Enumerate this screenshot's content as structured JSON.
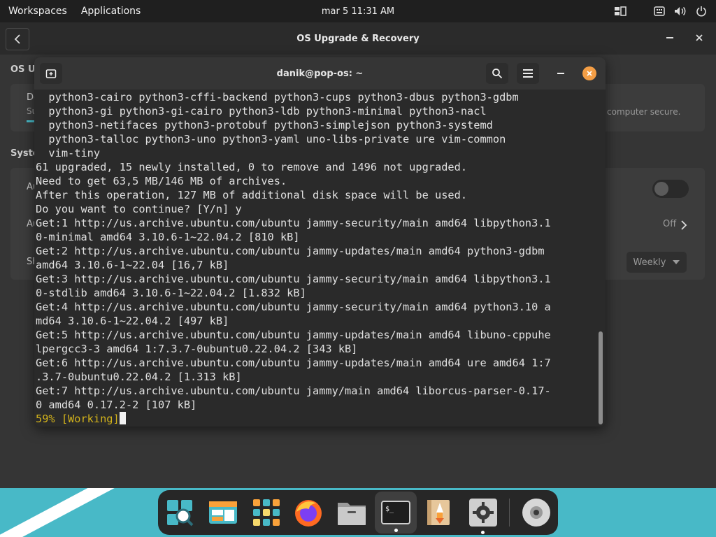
{
  "top_panel": {
    "workspaces": "Workspaces",
    "applications": "Applications",
    "clock": "mar 5  11:31 AM"
  },
  "settings": {
    "title": "OS Upgrade & Recovery",
    "section_title": "OS Up",
    "card_heading": "Do",
    "card_sub": "Su",
    "card_tail": "computer secure.",
    "system_label": "Syste",
    "row1": "Au",
    "row2": "Au",
    "row2_value": "Off",
    "row3": "Sh",
    "schedule_value": "Weekly"
  },
  "terminal": {
    "title": "danik@pop-os: ~",
    "lines": [
      "  python3-cairo python3-cffi-backend python3-cups python3-dbus python3-gdbm",
      "  python3-gi python3-gi-cairo python3-ldb python3-minimal python3-nacl",
      "  python3-netifaces python3-protobuf python3-simplejson python3-systemd",
      "  python3-talloc python3-uno python3-yaml uno-libs-private ure vim-common",
      "  vim-tiny",
      "61 upgraded, 15 newly installed, 0 to remove and 1496 not upgraded.",
      "Need to get 63,5 MB/146 MB of archives.",
      "After this operation, 127 MB of additional disk space will be used.",
      "Do you want to continue? [Y/n] y",
      "Get:1 http://us.archive.ubuntu.com/ubuntu jammy-security/main amd64 libpython3.1",
      "0-minimal amd64 3.10.6-1~22.04.2 [810 kB]",
      "Get:2 http://us.archive.ubuntu.com/ubuntu jammy-updates/main amd64 python3-gdbm",
      "amd64 3.10.6-1~22.04 [16,7 kB]",
      "Get:3 http://us.archive.ubuntu.com/ubuntu jammy-security/main amd64 libpython3.1",
      "0-stdlib amd64 3.10.6-1~22.04.2 [1.832 kB]",
      "Get:4 http://us.archive.ubuntu.com/ubuntu jammy-security/main amd64 python3.10 a",
      "md64 3.10.6-1~22.04.2 [497 kB]",
      "Get:5 http://us.archive.ubuntu.com/ubuntu jammy-updates/main amd64 libuno-cppuhe",
      "lpergcc3-3 amd64 1:7.3.7-0ubuntu0.22.04.2 [343 kB]",
      "Get:6 http://us.archive.ubuntu.com/ubuntu jammy-updates/main amd64 ure amd64 1:7",
      ".3.7-0ubuntu0.22.04.2 [1.313 kB]",
      "Get:7 http://us.archive.ubuntu.com/ubuntu jammy/main amd64 liborcus-parser-0.17-",
      "0 amd64 0.17.2-2 [107 kB]"
    ],
    "status": "59% [Working]"
  },
  "dock": {
    "items": [
      "search-app-icon",
      "shop-icon",
      "app-grid-icon",
      "firefox-icon",
      "files-icon",
      "terminal-icon",
      "popsicle-icon",
      "settings-icon",
      "disc-icon"
    ]
  },
  "colors": {
    "accent_orange": "#f49e45",
    "working_text": "#d3b31b",
    "dock_background": "#48b9c7"
  }
}
